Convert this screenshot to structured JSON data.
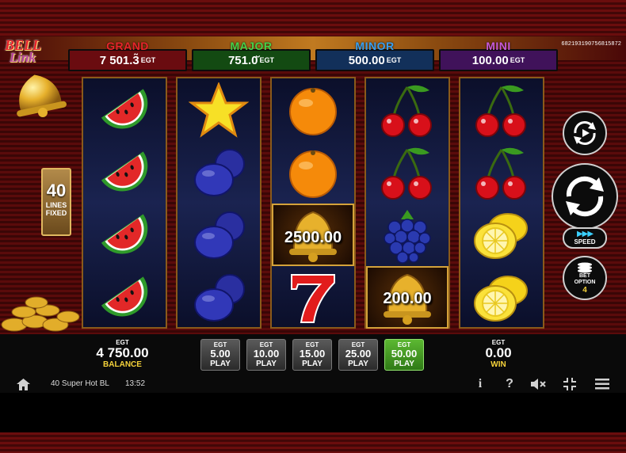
{
  "game_id": "6821931907568158​72",
  "logo": {
    "line1": "BELL",
    "line2": "Link"
  },
  "jackpots": [
    {
      "name": "GRAND",
      "value": "7 501.3̃",
      "currency": "EGT",
      "color": "#e8252b",
      "bg": "#6a0c10"
    },
    {
      "name": "MAJOR",
      "value": "751.0̆",
      "currency": "EGT",
      "color": "#46d24a",
      "bg": "#134a12"
    },
    {
      "name": "MINOR",
      "value": "500.00",
      "currency": "EGT",
      "color": "#3aa0f0",
      "bg": "#12305a"
    },
    {
      "name": "MINI",
      "value": "100.00",
      "currency": "EGT",
      "color": "#c65ad8",
      "bg": "#40125a"
    }
  ],
  "lines_panel": {
    "count": "40",
    "label1": "LINES",
    "label2": "FIXED"
  },
  "reels": [
    [
      "watermelon",
      "watermelon",
      "watermelon",
      "watermelon"
    ],
    [
      "star",
      "plum",
      "plum",
      "plum"
    ],
    [
      "orange",
      "orange",
      "bell",
      "seven"
    ],
    [
      "cherry",
      "cherry",
      "grapes",
      "bell"
    ],
    [
      "cherry",
      "cherry",
      "lemon",
      "lemon"
    ]
  ],
  "bell_values": {
    "reel3": "2500.00",
    "reel4": "200.00"
  },
  "controls": {
    "speed_label": "SPEED",
    "bet_option_label1": "BET",
    "bet_option_label2": "OPTION",
    "bet_option_value": "4"
  },
  "balance": {
    "currency": "EGT",
    "amount": "4 750.00",
    "label": "BALANCE"
  },
  "play_buttons": [
    {
      "currency": "EGT",
      "amount": "5.00",
      "label": "PLAY",
      "active": false
    },
    {
      "currency": "EGT",
      "amount": "10.00",
      "label": "PLAY",
      "active": false
    },
    {
      "currency": "EGT",
      "amount": "15.00",
      "label": "PLAY",
      "active": false
    },
    {
      "currency": "EGT",
      "amount": "25.00",
      "label": "PLAY",
      "active": false
    },
    {
      "currency": "EGT",
      "amount": "50.00",
      "label": "PLAY",
      "active": true
    }
  ],
  "win": {
    "currency": "EGT",
    "amount": "0.00",
    "label": "WIN"
  },
  "status_bar": {
    "game_name": "40 Super Hot BL",
    "time": "13:52"
  },
  "colors": {
    "accent_gold": "#d4a23a",
    "reel_bg": "#141b40",
    "active_green": "#4aa72a"
  }
}
